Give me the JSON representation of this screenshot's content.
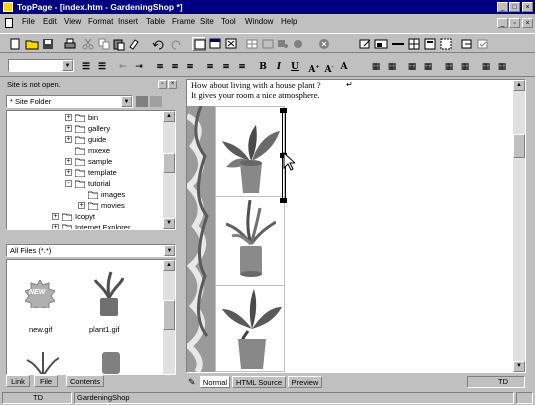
{
  "window": {
    "title": "TopPage - [index.htm - GardeningShop *]"
  },
  "menu": {
    "items": [
      "File",
      "Edit",
      "View",
      "Format",
      "Insert",
      "Table",
      "Frame",
      "Site",
      "Tool",
      "Window",
      "Help"
    ]
  },
  "left_panel": {
    "status": "Site is not open.",
    "folder_select": "* Site Folder",
    "tree": [
      {
        "label": "bin",
        "expander": "+"
      },
      {
        "label": "gallery",
        "expander": "+"
      },
      {
        "label": "guide",
        "expander": "+"
      },
      {
        "label": "mxexe",
        "expander": ""
      },
      {
        "label": "sample",
        "expander": "+"
      },
      {
        "label": "template",
        "expander": "+"
      },
      {
        "label": "tutorial",
        "expander": "-"
      },
      {
        "label": "images",
        "expander": ""
      },
      {
        "label": "movies",
        "expander": "+"
      },
      {
        "label": "Icopyt",
        "expander": "+"
      },
      {
        "label": "Internet Explorer",
        "expander": "+"
      }
    ],
    "filter_select": "All Files (*.*)",
    "files": [
      "new.gif",
      "plant1.gif"
    ],
    "new_badge": "NEW",
    "tabs": [
      "Link",
      "File",
      "Contents"
    ]
  },
  "editor": {
    "line1": "How about living with a house plant ?",
    "line2": "It gives your room a nice atmosphere.",
    "tabs": [
      "Normal",
      "HTML Source",
      "Preview"
    ],
    "mode": "TD"
  },
  "statusbar": {
    "left": "TD",
    "site": "GardeningShop"
  }
}
